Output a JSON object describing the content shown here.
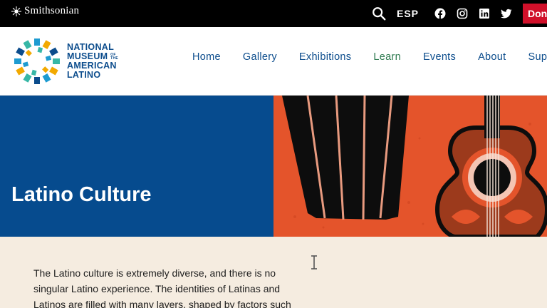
{
  "topbar": {
    "brand": "Smithsonian",
    "search_icon": "search-icon",
    "language": "ESP",
    "social": [
      "facebook-icon",
      "instagram-icon",
      "linkedin-icon",
      "twitter-icon"
    ],
    "donate_label": "Donate"
  },
  "header": {
    "logo_lines": [
      "NATIONAL",
      "MUSEUM",
      "AMERICAN",
      "LATINO"
    ],
    "logo_small": "OF THE",
    "nav": [
      {
        "label": "Home"
      },
      {
        "label": "Gallery"
      },
      {
        "label": "Exhibitions"
      },
      {
        "label": "Learn"
      },
      {
        "label": "Events"
      },
      {
        "label": "About"
      },
      {
        "label": "Sup"
      }
    ]
  },
  "hero": {
    "title": "Latino Culture"
  },
  "content": {
    "intro": "The Latino culture is extremely diverse, and there is no singular Latino experience. The identities of Latinas and Latinos are filled with many layers, shaped by factors such"
  },
  "colors": {
    "topbar": "#000000",
    "donate": "#d0102a",
    "brand_blue": "#0b4c8c",
    "hero_blue": "#064b8e",
    "active_nav": "#2d7a4f",
    "hero_orange": "#e4542b",
    "content_bg": "#f5ece0"
  }
}
